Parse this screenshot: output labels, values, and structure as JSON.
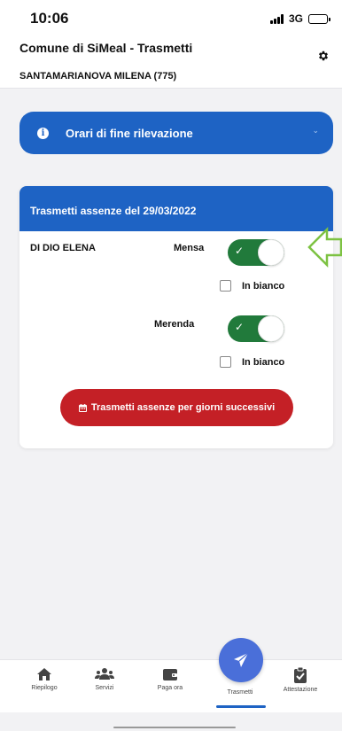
{
  "status_bar": {
    "time": "10:06",
    "network": "3G"
  },
  "header": {
    "title": "Comune di SiMeal - Trasmetti",
    "user": "SANTAMARIANOVA MILENA (775)"
  },
  "info_banner": {
    "label": "Orari di fine rilevazione"
  },
  "card": {
    "title": "Trasmetti assenze del 29/03/2022",
    "pupil": "DI DIO ELENA",
    "meals": [
      {
        "label": "Mensa",
        "enabled": true,
        "blank_label": "In bianco",
        "blank_checked": false
      },
      {
        "label": "Merenda",
        "enabled": true,
        "blank_label": "In bianco",
        "blank_checked": false
      }
    ],
    "send_button": "Trasmetti assenze per giorni successivi"
  },
  "tabbar": {
    "items": [
      {
        "label": "Riepilogo",
        "icon": "home-icon"
      },
      {
        "label": "Servizi",
        "icon": "users-icon"
      },
      {
        "label": "Paga ora",
        "icon": "wallet-icon"
      },
      {
        "label": "Trasmetti",
        "icon": "paper-plane-icon",
        "active": true
      },
      {
        "label": "Attestazione",
        "icon": "clipboard-check-icon"
      }
    ]
  },
  "colors": {
    "primary": "#1e63c4",
    "toggle_on": "#217a3b",
    "danger": "#c42026",
    "fab": "#4a6fd9",
    "annotation_arrow": "#7dc242"
  }
}
